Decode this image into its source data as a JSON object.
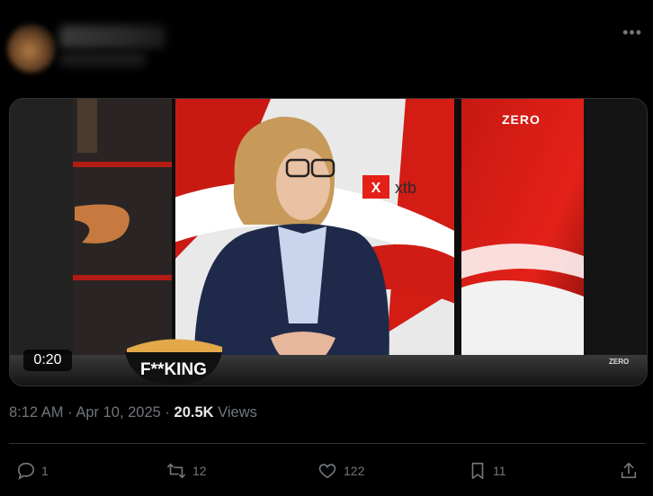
{
  "post": {
    "video_duration": "0:20",
    "video_overlay": {
      "brand_logo": "ZERO",
      "sponsor_text": "xtb",
      "sponsor_mark": "X",
      "bowl_text": "F**KING",
      "corner_logo": "ZERO"
    },
    "time": "8:12 AM",
    "separator": "·",
    "date": "Apr 10, 2025",
    "views_count": "20.5K",
    "views_label": "Views"
  },
  "actions": {
    "reply_count": "1",
    "repost_count": "12",
    "like_count": "122",
    "bookmark_count": "11"
  },
  "icons": [
    "more-icon",
    "reply-icon",
    "repost-icon",
    "like-icon",
    "bookmark-icon",
    "share-icon"
  ],
  "colors": {
    "background": "#000000",
    "text": "#e7e9ea",
    "muted": "#71767b",
    "border": "#2f3336",
    "accent_red": "#e32119"
  }
}
